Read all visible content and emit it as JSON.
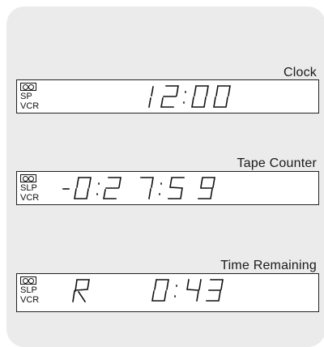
{
  "panels": [
    {
      "id": "clock",
      "title": "Clock",
      "mode": "SP",
      "source": "VCR",
      "display": "12:00"
    },
    {
      "id": "counter",
      "title": "Tape Counter",
      "mode": "SLP",
      "source": "VCR",
      "display": "-0:27:59"
    },
    {
      "id": "remaining",
      "title": "Time Remaining",
      "mode": "SLP",
      "source": "VCR",
      "display": "R 0:43"
    }
  ],
  "icons": {
    "tape": "cassette-icon"
  }
}
